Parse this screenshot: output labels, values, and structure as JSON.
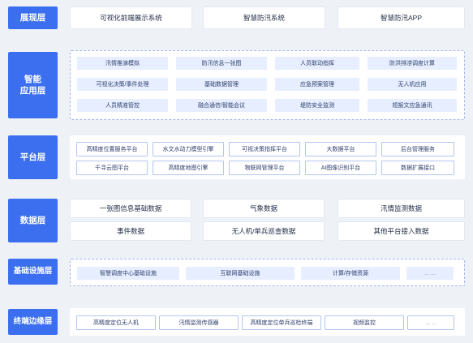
{
  "layers": [
    {
      "label": "展现层",
      "items": [
        "可视化前端展示系统",
        "智慧防汛系统",
        "智慧防汛APP"
      ]
    },
    {
      "label_lines": [
        "智能",
        "应用层"
      ],
      "items": [
        "汛情推演模拟",
        "防汛信息一张图",
        "人员联动指挥",
        "防洪排涝调度计算",
        "可视化决策/事件处理",
        "基础数据管理",
        "应急预案管理",
        "无人机应用",
        "人员精准管控",
        "融合通信/智能会议",
        "堤防安全监测",
        "短报文应急通讯"
      ]
    },
    {
      "label": "平台层",
      "items": [
        "高精度位置服务平台",
        "水文水动力模型引擎",
        "可视决策指挥平台",
        "大数据平台",
        "后台管理服务",
        "千寻云图平台",
        "高精度地图引擎",
        "物联网管理平台",
        "AI图像识别平台",
        "数据扩展接口"
      ]
    },
    {
      "label": "数据层",
      "items": [
        "一张图信息基础数据",
        "气象数据",
        "汛情监测数据",
        "事件数据",
        "无人机/单兵巡查数据",
        "其他平台接入数据"
      ]
    },
    {
      "label": "基础设施层",
      "items": [
        "智慧调度中心基础设施",
        "互联网基础设施",
        "计算/存储资源",
        "... ..."
      ]
    },
    {
      "label": "终端边缘层",
      "items": [
        "高精度定位无人机",
        "汛情监测传感器",
        "高精度定位单兵巡检终端",
        "视频监控",
        "... ..."
      ]
    }
  ]
}
